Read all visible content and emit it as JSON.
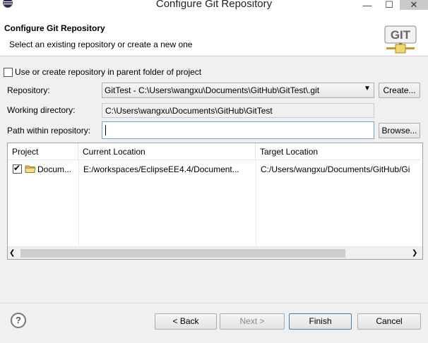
{
  "window": {
    "title": "Configure Git Repository",
    "minimize_glyph": "—",
    "maximize_glyph": "☐",
    "close_glyph": "✕"
  },
  "header": {
    "title": "Configure Git Repository",
    "description": "Select an existing repository or create a new one",
    "logo_text": "GIT"
  },
  "parent_option": {
    "label": "Use or create repository in parent folder of project",
    "checked": false
  },
  "repository": {
    "label": "Repository:",
    "selected": "GitTest - C:\\Users\\wangxu\\Documents\\GitHub\\GitTest\\.git",
    "create_label": "Create..."
  },
  "working_directory": {
    "label": "Working directory:",
    "value": "C:\\Users\\wangxu\\Documents\\GitHub\\GitTest"
  },
  "path": {
    "label": "Path within repository:",
    "value": "",
    "browse_label": "Browse..."
  },
  "table": {
    "columns": [
      "Project",
      "Current Location",
      "Target Location"
    ],
    "rows": [
      {
        "checked": true,
        "project": "Docum...",
        "current": "E:/workspaces/EclipseEE4.4/Document...",
        "target": "C:/Users/wangxu/Documents/GitHub/Gi"
      }
    ]
  },
  "footer": {
    "help_glyph": "?",
    "back_label": "< Back",
    "next_label": "Next >",
    "finish_label": "Finish",
    "cancel_label": "Cancel"
  },
  "colors": {
    "accent": "#3c7fb1",
    "dialog_bg": "#f0f0f0"
  },
  "icons": [
    "eclipse-app-icon",
    "git-logo-icon",
    "folder-icon",
    "help-icon",
    "chevron-down-icon"
  ]
}
